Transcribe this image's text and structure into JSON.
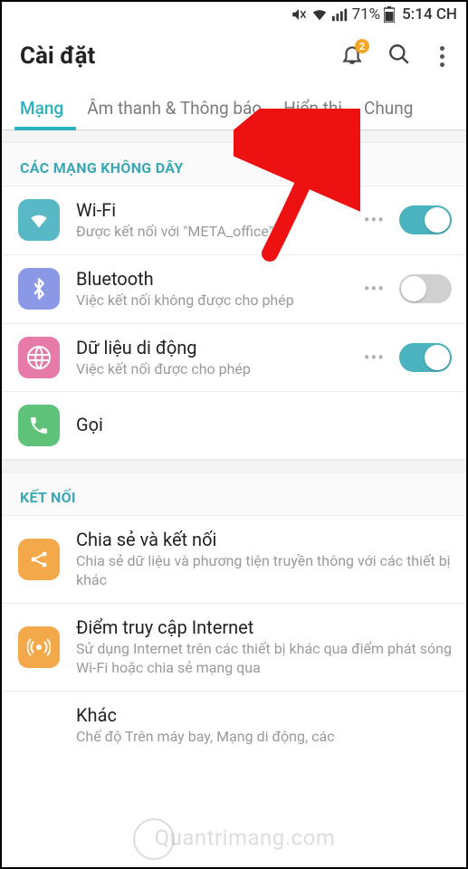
{
  "status": {
    "battery_pct": "71%",
    "time": "5:14 CH"
  },
  "header": {
    "title": "Cài đặt",
    "badge": "2"
  },
  "tabs": [
    {
      "label": "Mạng",
      "active": true
    },
    {
      "label": "Âm thanh & Thông báo",
      "active": false
    },
    {
      "label": "Hiển thị",
      "active": false
    },
    {
      "label": "Chung",
      "active": false
    }
  ],
  "sections": {
    "wireless": {
      "header": "CÁC MẠNG KHÔNG DÂY",
      "items": {
        "wifi": {
          "title": "Wi-Fi",
          "sub": "Được kết nối với \"META_office\"",
          "toggle": true
        },
        "bt": {
          "title": "Bluetooth",
          "sub": "Việc kết nối không được cho phép",
          "toggle": false
        },
        "data": {
          "title": "Dữ liệu di động",
          "sub": "Việc kết nối được cho phép",
          "toggle": true
        },
        "call": {
          "title": "Gọi"
        }
      }
    },
    "connect": {
      "header": "KẾT NỐI",
      "items": {
        "share": {
          "title": "Chia sẻ và kết nối",
          "sub": "Chia sẻ dữ liệu và phương tiện truyền thông với các thiết bị khác"
        },
        "hotspot": {
          "title": "Điểm truy cập Internet",
          "sub": "Sử dụng Internet trên các thiết bị khác qua điểm phát sóng Wi-Fi hoặc chia sẻ mạng qua"
        },
        "other": {
          "title": "Khác",
          "sub": "Chế độ Trên máy bay, Mạng di động, các"
        }
      }
    }
  },
  "watermark": "uantrimang.com",
  "icons": {
    "wifi": "wifi-icon",
    "bt": "bluetooth-icon",
    "data": "mobile-data-icon",
    "call": "phone-icon",
    "share": "share-icon",
    "hotspot": "hotspot-icon"
  },
  "colors": {
    "accent": "#2ab1bf",
    "toggle_on": "#4bb3bf"
  }
}
